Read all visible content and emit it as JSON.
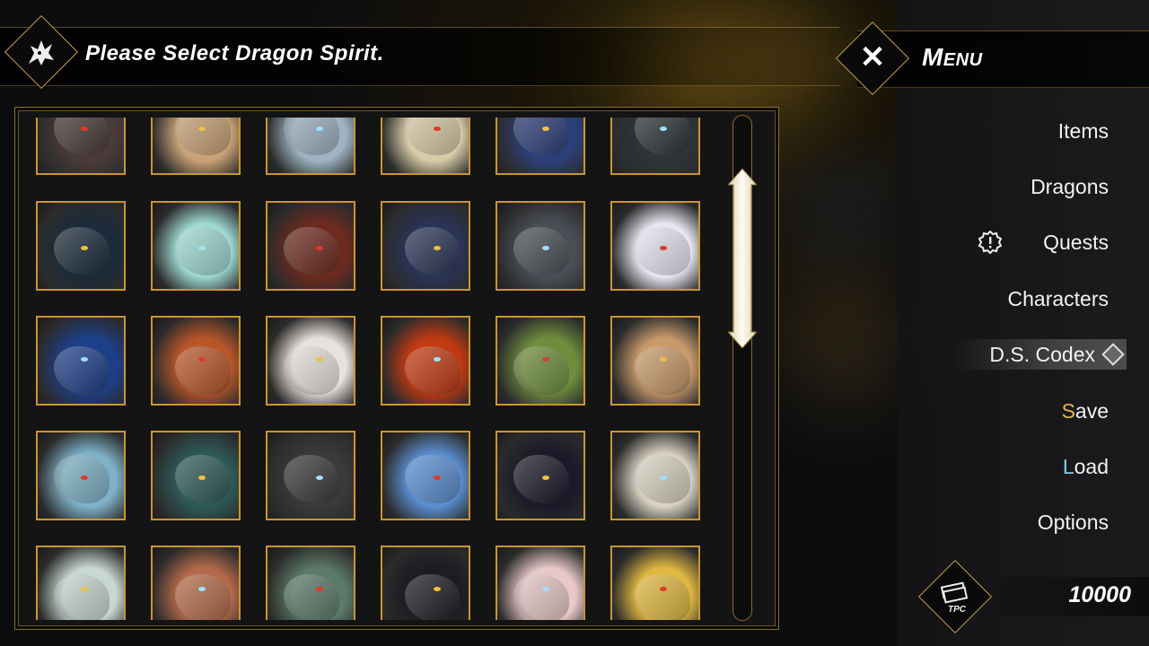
{
  "header": {
    "title": "Please Select Dragon Spirit.",
    "icon": "dragon-head-icon"
  },
  "menu": {
    "title": "Menu",
    "close_icon": "close-icon",
    "items": [
      {
        "label": "Items"
      },
      {
        "label": "Dragons"
      },
      {
        "label": "Quests",
        "badge": "alert-gear-icon"
      },
      {
        "label": "Characters"
      },
      {
        "label": "D.S. Codex",
        "active": true
      },
      {
        "accent": "S",
        "rest": "ave",
        "accent_color": "#e7b64a"
      },
      {
        "accent": "L",
        "rest": "oad",
        "accent_color": "#7fd1e6"
      },
      {
        "label": "Options"
      }
    ]
  },
  "currency": {
    "label": "TPC",
    "value": "10000",
    "icon": "money-stack-icon"
  },
  "colors": {
    "gold_border": "#c99632",
    "panel_bg": "#141414",
    "accent_gold": "#c9a14e"
  },
  "dragon_tiles": [
    [
      "#4a3a3a",
      "#c9a277",
      "#9fb3c2",
      "#d8cba8",
      "#2c3f7a",
      "#2f3438"
    ],
    [
      "#1b2b3a",
      "#9ed9d2",
      "#6e2a1e",
      "#2a3456",
      "#4b4f55",
      "#e8e6f0"
    ],
    [
      "#1d3f8a",
      "#b8562a",
      "#e8e2dc",
      "#c23a12",
      "#6f8e3c",
      "#c89a6a"
    ],
    [
      "#7fb2c8",
      "#2f5a5a",
      "#3b3a3a",
      "#5b8ed0",
      "#1a1a2a",
      "#d8d2c2"
    ],
    [
      "#c8d8d0",
      "#b46a4a",
      "#5c7a6a",
      "#1c1c22",
      "#e8c8c8",
      "#e0b840"
    ]
  ]
}
